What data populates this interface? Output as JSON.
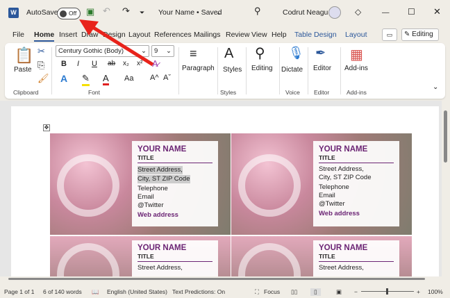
{
  "titlebar": {
    "autosave_label": "AutoSave",
    "autosave_state": "Off",
    "doc_title": "Your Name • Saved",
    "user": "Codrut Neagu"
  },
  "tabs": [
    "File",
    "Home",
    "Insert",
    "Draw",
    "Design",
    "Layout",
    "References",
    "Mailings",
    "Review",
    "View",
    "Help",
    "Table Design",
    "Layout"
  ],
  "editing_button": "Editing",
  "ribbon": {
    "font_name": "Century Gothic (Body)",
    "font_size": "9",
    "paste": "Paste",
    "paragraph": "Paragraph",
    "styles": "Styles",
    "editing": "Editing",
    "dictate": "Dictate",
    "editor": "Editor",
    "addins": "Add-ins",
    "groups": {
      "clipboard": "Clipboard",
      "font": "Font",
      "styles": "Styles",
      "voice": "Voice",
      "editor": "Editor",
      "addins": "Add-ins"
    },
    "font_buttons": {
      "bold": "B",
      "italic": "I",
      "underline": "U",
      "strike": "ab",
      "subscript": "x₂",
      "superscript": "x²",
      "case": "Aa",
      "grow": "A^",
      "shrink": "Aˇ"
    }
  },
  "card": {
    "name": "YOUR NAME",
    "title": "TITLE",
    "address1": "Street Address,",
    "address2": "City, ST ZIP Code",
    "phone": "Telephone",
    "email": "Email",
    "twitter": "@Twitter",
    "web": "Web address"
  },
  "status": {
    "page": "Page 1 of 1",
    "words": "6 of 140 words",
    "language": "English (United States)",
    "predictions": "Text Predictions: On",
    "focus": "Focus",
    "zoom": "100%",
    "zoom_percent": 100
  },
  "colors": {
    "accent": "#6b2474",
    "word_blue": "#2b579a",
    "arrow": "#e8231b"
  }
}
